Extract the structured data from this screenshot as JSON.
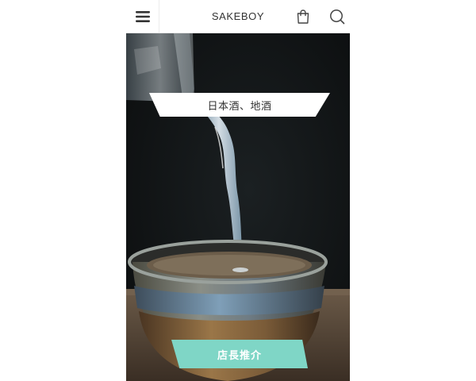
{
  "header": {
    "brand": "SAKEBOY",
    "menu_icon": "hamburger-menu-icon",
    "cart_icon": "shopping-bag-icon",
    "search_icon": "search-icon"
  },
  "hero": {
    "title": "日本酒、地酒",
    "cta_label": "店長推介",
    "image_desc_icon": "sake-pour-photo",
    "cta_color": "#7fd6c6"
  }
}
